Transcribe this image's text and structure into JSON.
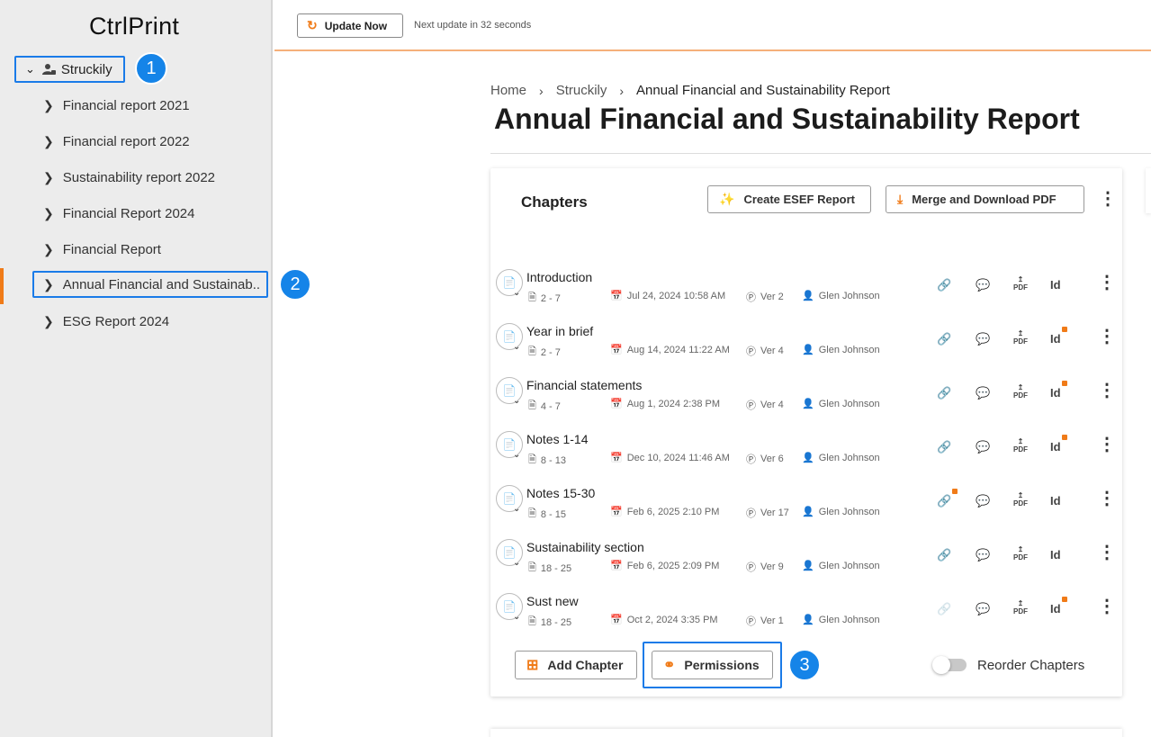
{
  "app": {
    "logo": "CtrlPrint"
  },
  "sidebar": {
    "root": {
      "label": "Struckily"
    },
    "items": [
      {
        "label": "Financial report 2021"
      },
      {
        "label": "Financial report 2022"
      },
      {
        "label": "Sustainability report 2022"
      },
      {
        "label": "Financial Report 2024"
      },
      {
        "label": "Financial Report"
      },
      {
        "label": "Annual Financial and Sustainab.."
      },
      {
        "label": "ESG Report 2024"
      }
    ]
  },
  "badges": [
    "1",
    "2",
    "3"
  ],
  "topbar": {
    "update_label": "Update Now",
    "next_update": "Next update in 32 seconds"
  },
  "breadcrumb": [
    "Home",
    "Struckily",
    "Annual Financial and Sustainability Report"
  ],
  "page": {
    "title": "Annual Financial and Sustainability Report"
  },
  "chapters": {
    "title": "Chapters",
    "esef_label": "Create ESEF Report",
    "merge_label": "Merge and Download PDF",
    "rows": [
      {
        "name": "Introduction",
        "pages": "2 - 7",
        "date": "Jul 24, 2024 10:58 AM",
        "version": "Ver 2",
        "author": "Glen Johnson",
        "link_locked": false,
        "id_locked": false,
        "link_faded": false
      },
      {
        "name": "Year in brief",
        "pages": "2 - 7",
        "date": "Aug 14, 2024 11:22 AM",
        "version": "Ver 4",
        "author": "Glen Johnson",
        "link_locked": false,
        "id_locked": true,
        "link_faded": false
      },
      {
        "name": "Financial statements",
        "pages": "4 - 7",
        "date": "Aug 1, 2024 2:38 PM",
        "version": "Ver 4",
        "author": "Glen Johnson",
        "link_locked": false,
        "id_locked": true,
        "link_faded": false
      },
      {
        "name": "Notes 1-14",
        "pages": "8 - 13",
        "date": "Dec 10, 2024 11:46 AM",
        "version": "Ver 6",
        "author": "Glen Johnson",
        "link_locked": false,
        "id_locked": true,
        "link_faded": false
      },
      {
        "name": "Notes 15-30",
        "pages": "8 - 15",
        "date": "Feb 6, 2025 2:10 PM",
        "version": "Ver 17",
        "author": "Glen Johnson",
        "link_locked": true,
        "id_locked": false,
        "link_faded": false
      },
      {
        "name": "Sustainability section",
        "pages": "18 - 25",
        "date": "Feb 6, 2025 2:09 PM",
        "version": "Ver 9",
        "author": "Glen Johnson",
        "link_locked": false,
        "id_locked": false,
        "link_faded": false
      },
      {
        "name": "Sust new",
        "pages": "18 - 25",
        "date": "Oct 2, 2024 3:35 PM",
        "version": "Ver 1",
        "author": "Glen Johnson",
        "link_locked": false,
        "id_locked": true,
        "link_faded": true
      }
    ],
    "pdf_label": "PDF",
    "id_label": "Id",
    "add_label": "Add Chapter",
    "permissions_label": "Permissions",
    "reorder_label": "Reorder Chapters"
  },
  "colors": {
    "accent": "#f07b18",
    "highlight": "#1a7be8",
    "badge": "#1584e8"
  }
}
